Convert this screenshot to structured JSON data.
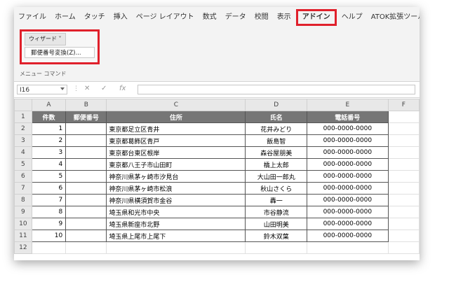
{
  "ribbon_tabs": [
    "ファイル",
    "ホーム",
    "タッチ",
    "挿入",
    "ページ レイアウト",
    "数式",
    "データ",
    "校閲",
    "表示",
    "アドイン",
    "ヘルプ",
    "ATOK拡張ツール"
  ],
  "active_tab": "アドイン",
  "addin": {
    "wizard_label": "ウィザード ˅",
    "menu_item": "郵便番号変換(Z)...",
    "group_label": "メニュー コマンド"
  },
  "formula_bar": {
    "name_box": "I16",
    "fx": "fx",
    "cancel": "✕",
    "enter": "✓",
    "dots": "⋮",
    "value": ""
  },
  "columns": [
    "A",
    "B",
    "C",
    "D",
    "E",
    "F"
  ],
  "header_row": [
    "件数",
    "郵便番号",
    "住所",
    "氏名",
    "電話番号"
  ],
  "rows": [
    {
      "n": "1",
      "zip": "",
      "addr": "東京都足立区青井",
      "name": "花井みどり",
      "tel": "000-0000-0000"
    },
    {
      "n": "2",
      "zip": "",
      "addr": "東京都葛飾区青戸",
      "name": "飯島智",
      "tel": "000-0000-0000"
    },
    {
      "n": "3",
      "zip": "",
      "addr": "東京都台東区根岸",
      "name": "森谷屋朋美",
      "tel": "000-0000-0000"
    },
    {
      "n": "4",
      "zip": "",
      "addr": "東京都八王子市山田町",
      "name": "橋上太郎",
      "tel": "000-0000-0000"
    },
    {
      "n": "5",
      "zip": "",
      "addr": "神奈川県茅ヶ崎市汐見台",
      "name": "大山田一郎丸",
      "tel": "000-0000-0000"
    },
    {
      "n": "6",
      "zip": "",
      "addr": "神奈川県茅ヶ崎市松浪",
      "name": "秋山さくら",
      "tel": "000-0000-0000"
    },
    {
      "n": "7",
      "zip": "",
      "addr": "神奈川県横須賀市金谷",
      "name": "轟一",
      "tel": "000-0000-0000"
    },
    {
      "n": "8",
      "zip": "",
      "addr": "埼玉県和光市中央",
      "name": "市谷静流",
      "tel": "000-0000-0000"
    },
    {
      "n": "9",
      "zip": "",
      "addr": "埼玉県新座市北野",
      "name": "山田明美",
      "tel": "000-0000-0000"
    },
    {
      "n": "10",
      "zip": "",
      "addr": "埼玉県上尾市上尾下",
      "name": "鈴木双葉",
      "tel": "000-0000-0000"
    }
  ],
  "row_numbers": [
    "1",
    "2",
    "3",
    "4",
    "5",
    "6",
    "7",
    "8",
    "9",
    "10",
    "11",
    "12"
  ]
}
